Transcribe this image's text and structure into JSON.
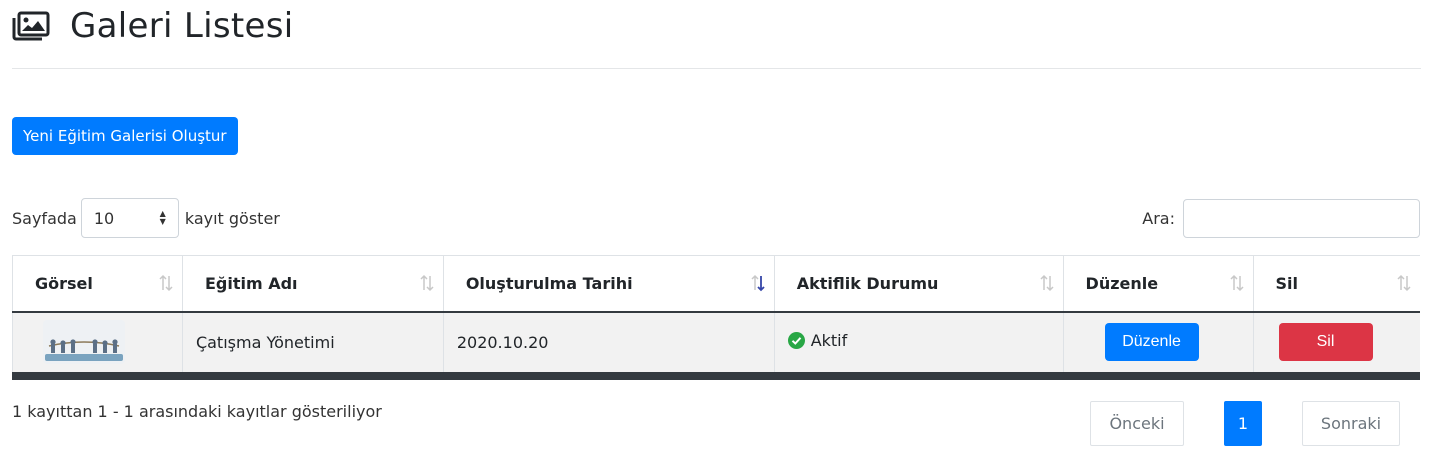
{
  "header": {
    "title": "Galeri Listesi",
    "icon": "gallery-icon"
  },
  "toolbar": {
    "create_label": "Yeni Eğitim Galerisi Oluştur"
  },
  "length": {
    "prefix": "Sayfada",
    "value": "10",
    "suffix": "kayıt göster"
  },
  "search": {
    "label": "Ara:",
    "value": ""
  },
  "table": {
    "columns": [
      "Görsel",
      "Eğitim Adı",
      "Oluşturulma Tarihi",
      "Aktiflik Durumu",
      "Düzenle",
      "Sil"
    ],
    "sorted_column": "Oluşturulma Tarihi",
    "rows": [
      {
        "name": "Çatışma Yönetimi",
        "date": "2020.10.20",
        "status": "Aktif",
        "edit": "Düzenle",
        "delete": "Sil"
      }
    ]
  },
  "info": "1 kayıttan 1 - 1 arasındaki kayıtlar gösteriliyor",
  "pagination": {
    "prev": "Önceki",
    "current": "1",
    "next": "Sonraki"
  },
  "colors": {
    "primary": "#007bff",
    "danger": "#dc3545",
    "success": "#28a745",
    "dark": "#343a40"
  }
}
